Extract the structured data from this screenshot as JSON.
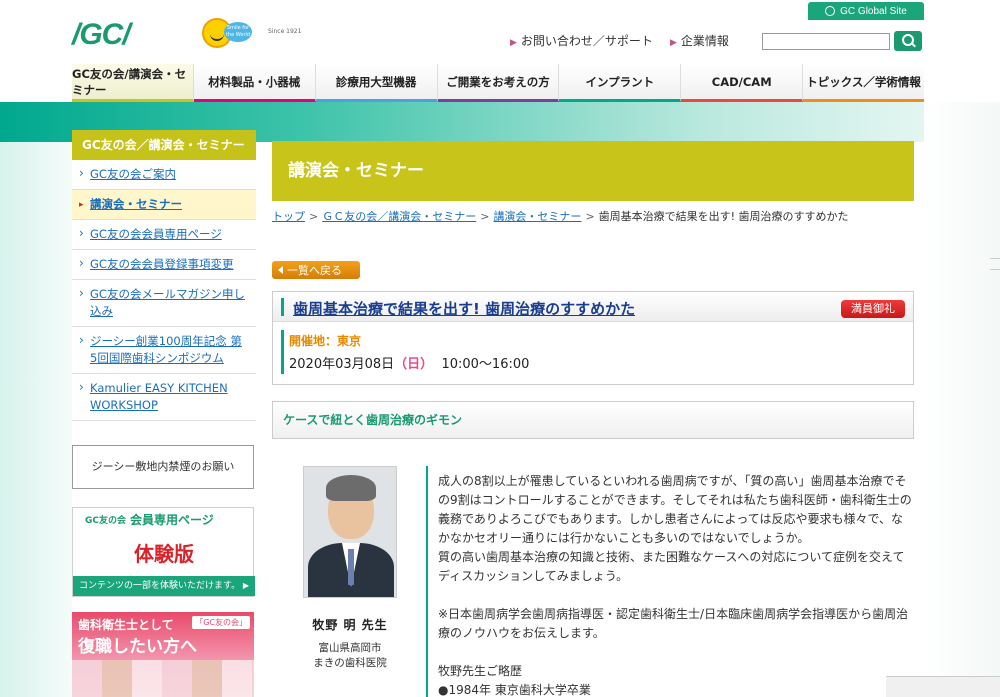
{
  "header": {
    "logo_text": "/GC/",
    "smile_tag": "Smile for the World",
    "since_text": "Since 1921",
    "global_link": "GC Global Site",
    "contact_link": "お問い合わせ／サポート",
    "company_link": "企業情報",
    "search": {
      "value": "",
      "placeholder": ""
    }
  },
  "nav": {
    "items": [
      {
        "label": "GC友の会/講演会・セミナー",
        "color": "#c8c41a"
      },
      {
        "label": "材料製品・小器械",
        "color": "#e4007f"
      },
      {
        "label": "診療用大型機器",
        "color": "#4aa3df"
      },
      {
        "label": "ご開業をお考えの方",
        "color": "#7b3fa0"
      },
      {
        "label": "インプラント",
        "color": "#00a88e"
      },
      {
        "label": "CAD/CAM",
        "color": "#e94a3a"
      },
      {
        "label": "トピックス／学術情報",
        "color": "#f08c1a"
      }
    ]
  },
  "sidebar": {
    "heading": "GC友の会／講演会・セミナー",
    "items": [
      {
        "label": "GC友の会ご案内",
        "active": false
      },
      {
        "label": "講演会・セミナー",
        "active": true
      },
      {
        "label": "GC友の会会員専用ページ",
        "active": false
      },
      {
        "label": "GC友の会会員登録事項変更",
        "active": false
      },
      {
        "label": "GC友の会メールマガジン申し込み",
        "active": false
      },
      {
        "label": "ジーシー創業100周年記念 第5回国際歯科シンポジウム",
        "active": false
      },
      {
        "label": "Kamulier EASY KITCHEN WORKSHOP",
        "active": false
      }
    ],
    "notice": "ジーシー敷地内禁煙のお願い",
    "member_banner": {
      "logo": "GC友の会",
      "title": "会員専用ページ",
      "main": "体験版",
      "footer": "コンテンツの一部を体験いただけます。"
    },
    "hygienist_banner": {
      "line1": "歯科衛生士として",
      "line2": "復職したい方へ",
      "badge": "「GC友の会」"
    }
  },
  "main": {
    "page_title": "講演会・セミナー",
    "breadcrumb": [
      {
        "label": "トップ",
        "link": true
      },
      {
        "label": "ＧＣ友の会／講演会・セミナー",
        "link": true
      },
      {
        "label": "講演会・セミナー",
        "link": true
      },
      {
        "label": "歯周基本治療で結果を出す! 歯周治療のすすめかた",
        "link": false
      }
    ],
    "breadcrumb_sep": ">",
    "back_button": "一覧へ戻る",
    "event": {
      "title": "歯周基本治療で結果を出す! 歯周治療のすすめかた",
      "status_badge": "満員御礼",
      "venue": "開催地：東京",
      "date": "2020年03月08日",
      "dow": "（日）",
      "time": "10:00〜16:00"
    },
    "theme": "ケースで紐とく歯周治療のギモン",
    "speaker": {
      "name": "牧野 明 先生",
      "aff1": "富山県高岡市",
      "aff2": "まきの歯科医院"
    },
    "description": {
      "para1": "成人の8割以上が罹患しているといわれる歯周病ですが、「質の高い」歯周基本治療でその9割はコントロールすることができます。そしてそれは私たち歯科医師・歯科衛生士の義務でありよろこびでもあります。しかし患者さんによっては反応や要求も様々で、なかなかセオリー通りには行かないことも多いのではないでしょうか。",
      "para2": "質の高い歯周基本治療の知識と技術、また困難なケースへの対応について症例を交えてディスカッションしてみましょう。",
      "para3": "※日本歯周病学会歯周病指導医・認定歯科衛生士/日本臨床歯周病学会指導医から歯周治療のノウハウをお伝えします。",
      "para4": "牧野先生ご略歴",
      "para5": "●1984年 東京歯科大学卒業"
    }
  }
}
